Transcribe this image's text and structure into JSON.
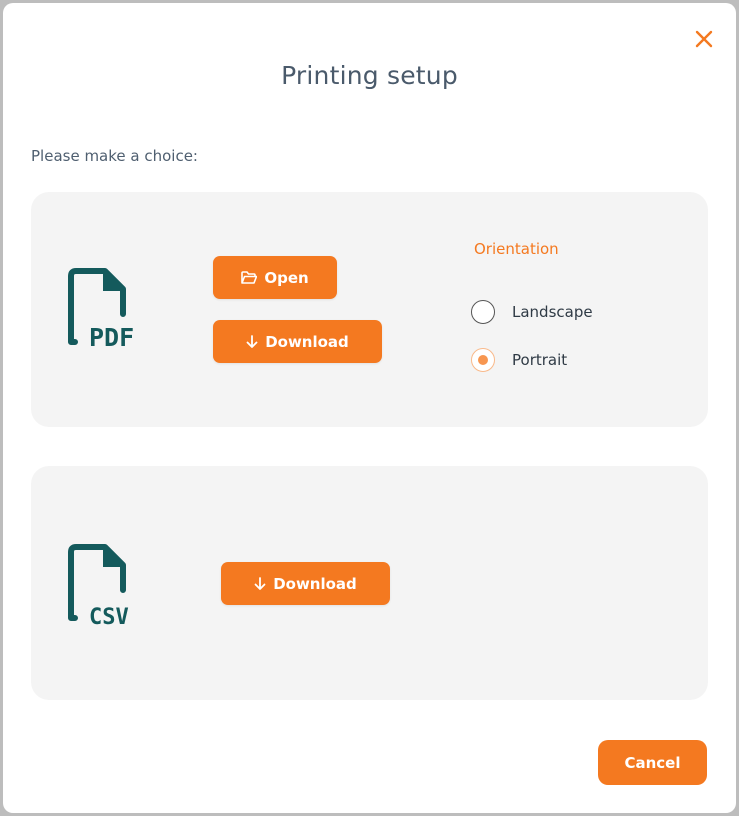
{
  "dialog": {
    "title": "Printing setup",
    "subtitle": "Please make a choice:",
    "close_icon": "close-icon"
  },
  "pdf_section": {
    "file_type": "PDF",
    "open_label": "Open",
    "download_label": "Download",
    "orientation": {
      "label": "Orientation",
      "options": [
        {
          "label": "Landscape",
          "selected": false
        },
        {
          "label": "Portrait",
          "selected": true
        }
      ]
    }
  },
  "csv_section": {
    "file_type": "CSV",
    "download_label": "Download"
  },
  "footer": {
    "cancel_label": "Cancel"
  },
  "colors": {
    "accent": "#f47920",
    "file_icon": "#145a5c",
    "title": "#4a5a6b",
    "panel_bg": "#f4f4f4"
  }
}
